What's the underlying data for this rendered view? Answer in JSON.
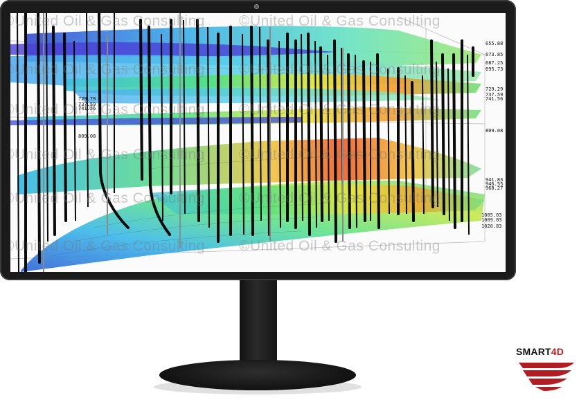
{
  "watermark": {
    "text": "©United Oil & Gas Consulting"
  },
  "depth_labels": {
    "l1": "655.88",
    "l2": "673.85",
    "l3": "687.25",
    "l4": "695.73",
    "l5": "729.29",
    "l6": "737.59",
    "l7": "741.56",
    "l8": "809.08",
    "l9": "941.83",
    "l10": "946.55",
    "l11": "968.27",
    "l12": "1005.03",
    "l13": "1009.03",
    "l14": "1020.83",
    "left1": "729.79",
    "left2": "737.59",
    "left3": "741.56",
    "left4": "809.08"
  },
  "logo": {
    "text_main": "SMART",
    "text_accent": "4D",
    "accent_color": "#b01e24"
  },
  "colors": {
    "bezel": "#1b1b1b",
    "screen_bg": "#fbfbfb"
  }
}
